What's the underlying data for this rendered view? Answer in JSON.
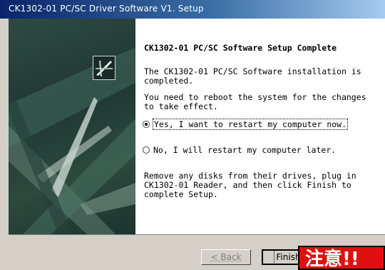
{
  "window": {
    "title": "CK1302-01 PC/SC Driver Software V1.  Setup"
  },
  "content": {
    "heading": "CK1302-01 PC/SC Software Setup Complete",
    "message1": "The CK1302-01 PC/SC Software installation is completed.",
    "message2": "You need to reboot the system for the changes to take effect.",
    "options": [
      {
        "label": "Yes, I want to restart my computer now.",
        "checked": true
      },
      {
        "label": "No, I will restart my computer later.",
        "checked": false
      }
    ],
    "message3": "Remove any disks from their drives, plug in CK1302-01 Reader, and then click Finish to complete Setup."
  },
  "buttons": {
    "back_label": "< Back",
    "finish_label": "Finish"
  },
  "overlay": {
    "warning_text": "注意!!"
  },
  "colors": {
    "title_gradient_start": "#0a246a",
    "title_gradient_end": "#a6caf0",
    "dialog_face": "#d4d0c8",
    "left_panel": "#2f4a44",
    "warning_red": "#e01010"
  },
  "icons": {
    "logo": "setup-logo-icon",
    "radio_selected": "radio-checked-icon",
    "radio_unselected": "radio-unchecked-icon"
  }
}
